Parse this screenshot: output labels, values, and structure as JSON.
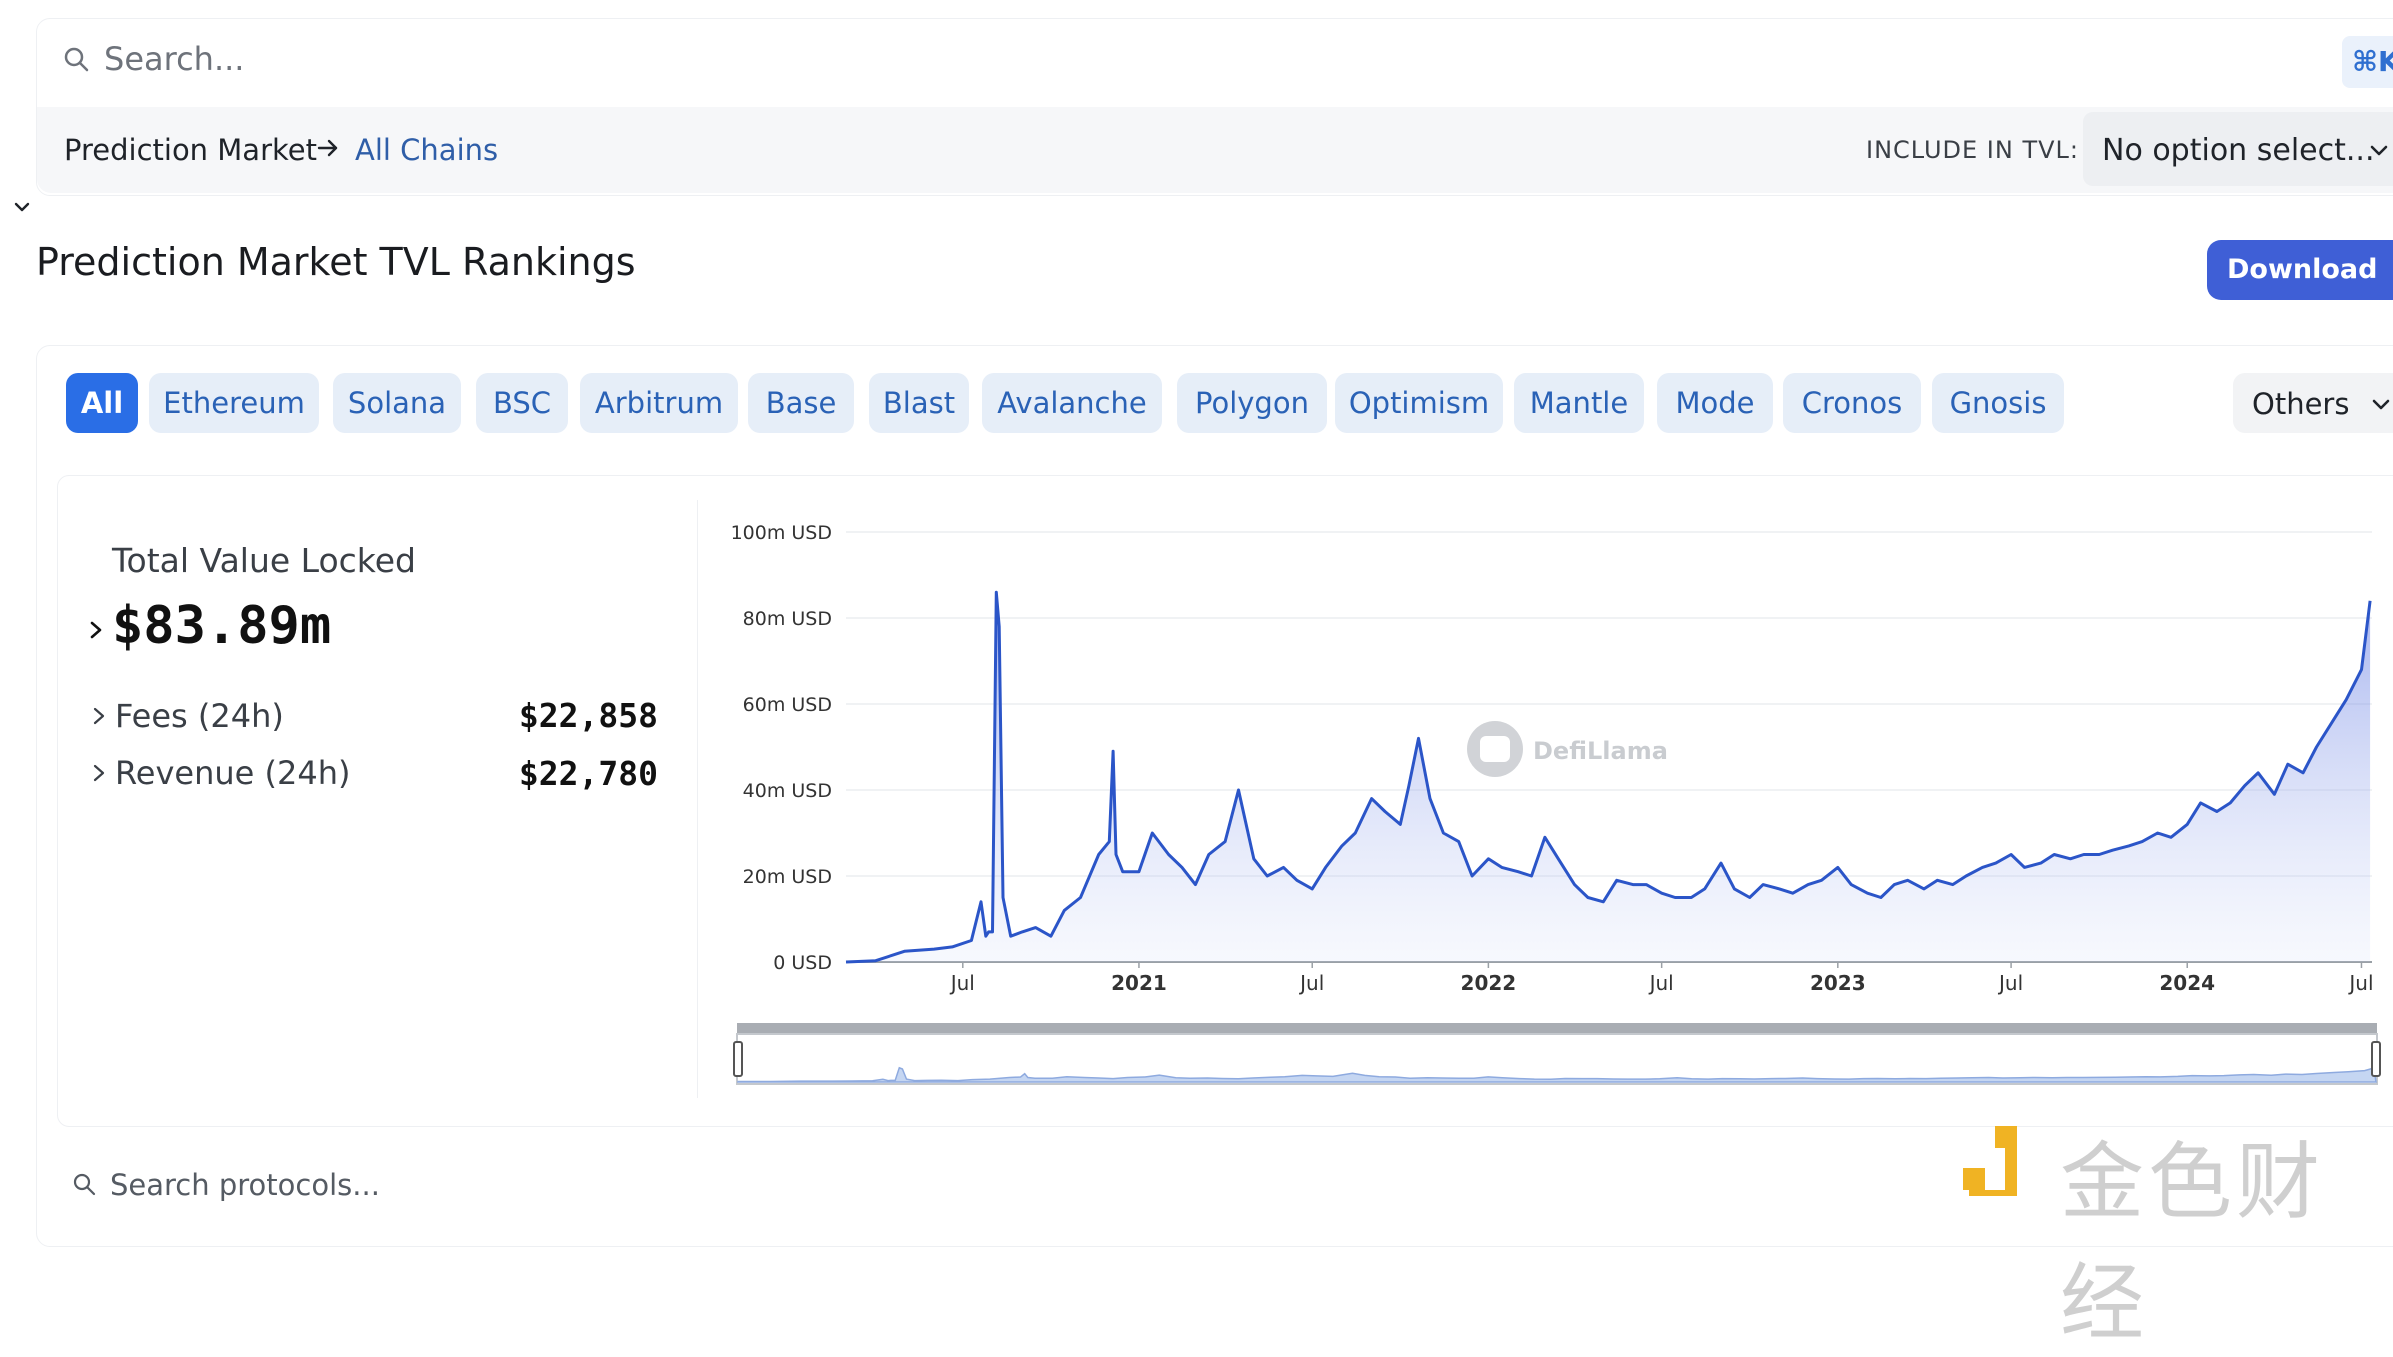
{
  "search": {
    "placeholder": "Search...",
    "shortcut": "⌘K"
  },
  "breadcrumb": {
    "category": "Prediction Market",
    "chain": "All Chains"
  },
  "include_tvl": {
    "label": "INCLUDE IN TVL:",
    "selected": "No option select..."
  },
  "page": {
    "title": "Prediction Market TVL Rankings",
    "download_label": "Download .csv"
  },
  "chains": {
    "items": [
      "All",
      "Ethereum",
      "Solana",
      "BSC",
      "Arbitrum",
      "Base",
      "Blast",
      "Avalanche",
      "Polygon",
      "Optimism",
      "Mantle",
      "Mode",
      "Cronos",
      "Gnosis"
    ],
    "active": "All",
    "others_label": "Others"
  },
  "stats": {
    "tvl_label": "Total Value Locked",
    "tvl_value": "$83.89m",
    "fees_label": "Fees (24h)",
    "fees_value": "$22,858",
    "revenue_label": "Revenue (24h)",
    "revenue_value": "$22,780"
  },
  "watermark": {
    "chart_logo": "DefiLlama",
    "corner_text": "金色财经"
  },
  "protocol_search": {
    "placeholder": "Search protocols..."
  },
  "colors": {
    "accent": "#2a6ee6",
    "chip_bg": "#e6eef8",
    "line": "#2b55c8",
    "download": "#3f5fd6"
  },
  "chart_data": {
    "type": "area",
    "title": "",
    "xlabel": "",
    "ylabel": "",
    "y_unit": "USD",
    "ylim": [
      0,
      100000000
    ],
    "yticks": [
      "0 USD",
      "20m USD",
      "40m USD",
      "60m USD",
      "80m USD",
      "100m USD"
    ],
    "xticks": [
      "Jul",
      "2021",
      "Jul",
      "2022",
      "Jul",
      "2023",
      "Jul",
      "2024",
      "Jul"
    ],
    "grid": true,
    "legend": "none",
    "series": [
      {
        "x": [
          "2020-03-01",
          "2020-04-01",
          "2020-05-01",
          "2020-06-01",
          "2020-06-20",
          "2020-07-10",
          "2020-07-20",
          "2020-07-25",
          "2020-07-28",
          "2020-08-01",
          "2020-08-05",
          "2020-08-08",
          "2020-08-12",
          "2020-08-20",
          "2020-09-01",
          "2020-09-15",
          "2020-10-01",
          "2020-10-15",
          "2020-11-01",
          "2020-11-20",
          "2020-12-01",
          "2020-12-05",
          "2020-12-08",
          "2020-12-15",
          "2021-01-01",
          "2021-01-15",
          "2021-02-01",
          "2021-02-15",
          "2021-03-01",
          "2021-03-15",
          "2021-04-01",
          "2021-04-15",
          "2021-05-01",
          "2021-05-15",
          "2021-06-01",
          "2021-06-15",
          "2021-07-01",
          "2021-07-15",
          "2021-08-01",
          "2021-08-15",
          "2021-09-01",
          "2021-09-15",
          "2021-10-01",
          "2021-10-10",
          "2021-10-20",
          "2021-11-01",
          "2021-11-15",
          "2021-12-01",
          "2021-12-15",
          "2022-01-01",
          "2022-01-15",
          "2022-02-01",
          "2022-02-15",
          "2022-03-01",
          "2022-03-15",
          "2022-04-01",
          "2022-04-15",
          "2022-05-01",
          "2022-05-15",
          "2022-06-01",
          "2022-06-15",
          "2022-07-01",
          "2022-07-15",
          "2022-08-01",
          "2022-08-15",
          "2022-09-01",
          "2022-09-15",
          "2022-10-01",
          "2022-10-15",
          "2022-11-01",
          "2022-11-15",
          "2022-12-01",
          "2022-12-15",
          "2023-01-01",
          "2023-01-15",
          "2023-02-01",
          "2023-02-15",
          "2023-03-01",
          "2023-03-15",
          "2023-04-01",
          "2023-04-15",
          "2023-05-01",
          "2023-05-15",
          "2023-06-01",
          "2023-06-15",
          "2023-07-01",
          "2023-07-15",
          "2023-08-01",
          "2023-08-15",
          "2023-09-01",
          "2023-09-15",
          "2023-10-01",
          "2023-10-15",
          "2023-11-01",
          "2023-11-15",
          "2023-12-01",
          "2023-12-15",
          "2024-01-01",
          "2024-01-15",
          "2024-02-01",
          "2024-02-15",
          "2024-03-01",
          "2024-03-15",
          "2024-04-01",
          "2024-04-15",
          "2024-05-01",
          "2024-05-15",
          "2024-06-01",
          "2024-06-15",
          "2024-07-01",
          "2024-07-10"
        ],
        "values": [
          0,
          0.3,
          2.5,
          3,
          3.5,
          5,
          14,
          6,
          7,
          7,
          86,
          78,
          15,
          6,
          7,
          8,
          6,
          12,
          15,
          25,
          28,
          49,
          25,
          21,
          21,
          30,
          25,
          22,
          18,
          25,
          28,
          40,
          24,
          20,
          22,
          19,
          17,
          22,
          27,
          30,
          38,
          35,
          32,
          41,
          52,
          38,
          30,
          28,
          20,
          24,
          22,
          21,
          20,
          29,
          24,
          18,
          15,
          14,
          19,
          18,
          18,
          16,
          15,
          15,
          17,
          23,
          17,
          15,
          18,
          17,
          16,
          18,
          19,
          22,
          18,
          16,
          15,
          18,
          19,
          17,
          19,
          18,
          20,
          22,
          23,
          25,
          22,
          23,
          25,
          24,
          25,
          25,
          26,
          27,
          28,
          30,
          29,
          32,
          37,
          35,
          37,
          41,
          44,
          39,
          46,
          44,
          50,
          56,
          61,
          68,
          84
        ]
      }
    ]
  }
}
